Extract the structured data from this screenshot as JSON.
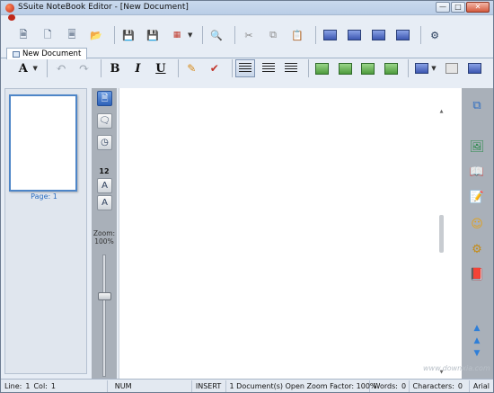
{
  "window": {
    "title": "SSuite NoteBook Editor - [New Document]",
    "controls": [
      "minimize",
      "maximize",
      "close"
    ]
  },
  "toolbar1": {
    "buttons": [
      {
        "name": "new-document",
        "icon": "new-document-icon"
      },
      {
        "name": "new-page",
        "icon": "page-icon"
      },
      {
        "name": "properties",
        "icon": "page-properties-icon"
      },
      {
        "name": "open",
        "icon": "folder-open-icon"
      },
      {
        "name": "save",
        "icon": "floppy-icon"
      },
      {
        "name": "save-as",
        "icon": "floppy-red-icon"
      },
      {
        "name": "pdf",
        "icon": "pdf-icon"
      },
      {
        "name": "print-preview",
        "icon": "print-preview-icon"
      },
      {
        "name": "cut",
        "icon": "scissors-icon"
      },
      {
        "name": "copy",
        "icon": "copy-icon"
      },
      {
        "name": "paste",
        "icon": "paste-icon"
      },
      {
        "name": "layout-1",
        "icon": "layout-icon"
      },
      {
        "name": "layout-2",
        "icon": "layout-icon"
      },
      {
        "name": "layout-3",
        "icon": "layout-icon"
      },
      {
        "name": "layout-4",
        "icon": "layout-icon"
      },
      {
        "name": "settings",
        "icon": "window-settings-icon"
      }
    ]
  },
  "tabs": [
    {
      "label": "New Document",
      "active": true
    }
  ],
  "toolbar2": {
    "font_button": "A",
    "bold": "B",
    "italic": "I",
    "underline": "U"
  },
  "thumbnail": {
    "label": "Page: 1"
  },
  "vtools": {
    "font_size": "12",
    "zoom_label": "Zoom:",
    "zoom_value": "100%",
    "zoom_level": 0.33
  },
  "statusbar": {
    "line_label": "Line:",
    "line_value": "1",
    "col_label": "Col:",
    "col_value": "1",
    "num": "NUM",
    "insert": "INSERT",
    "info": "1 Document(s) Open Zoom Factor: 100%",
    "words_label": "Words:",
    "words_value": "0",
    "chars_label": "Characters:",
    "chars_value": "0",
    "font": "Arial"
  },
  "watermark": "www.downxia.com",
  "colors": {
    "title_bar": "#c9d9ed",
    "side_strip": "#a9b0b9",
    "accent_blue": "#2c6ec0"
  }
}
